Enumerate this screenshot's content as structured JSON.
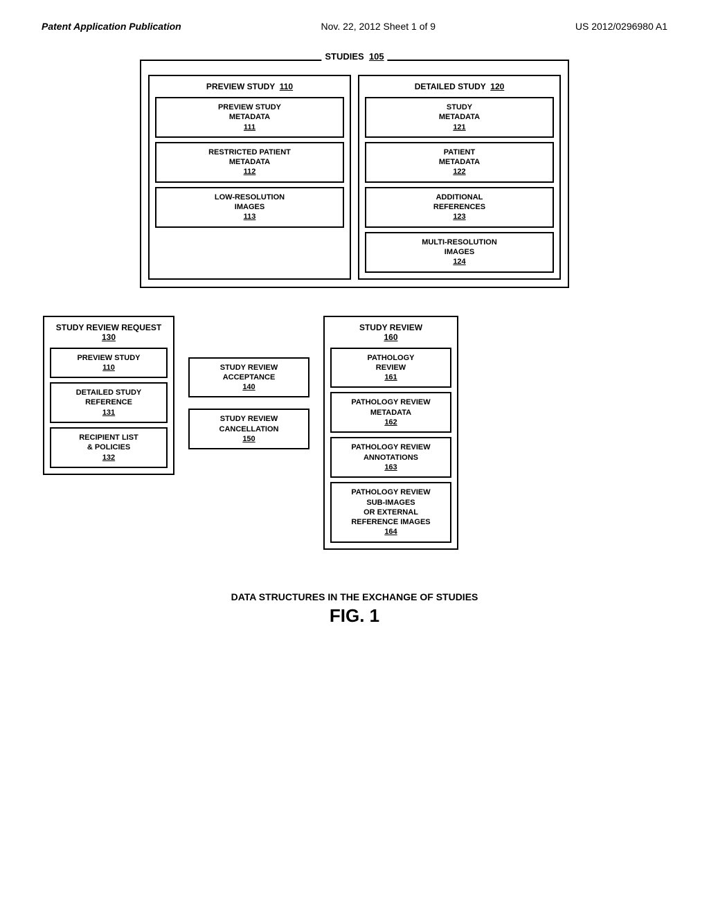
{
  "header": {
    "left": "Patent Application Publication",
    "center": "Nov. 22, 2012   Sheet 1 of 9",
    "right": "US 2012/0296980 A1"
  },
  "top_diagram": {
    "title": "STUDIES",
    "title_ref": "105",
    "preview_study": {
      "label": "PREVIEW STUDY",
      "ref": "110",
      "boxes": [
        {
          "label": "PREVIEW STUDY\nMETADATA",
          "ref": "111"
        },
        {
          "label": "RESTRICTED PATIENT\nMETADATA",
          "ref": "112"
        },
        {
          "label": "LOW-RESOLUTION\nIMAGES",
          "ref": "113"
        }
      ]
    },
    "detailed_study": {
      "label": "DETAILED STUDY",
      "ref": "120",
      "boxes": [
        {
          "label": "STUDY\nMETADATA",
          "ref": "121"
        },
        {
          "label": "PATIENT\nMETADATA",
          "ref": "122"
        },
        {
          "label": "ADDITIONAL\nREFERENCES",
          "ref": "123"
        },
        {
          "label": "MULTI-RESOLUTION\nIMAGES",
          "ref": "124"
        }
      ]
    }
  },
  "bottom_diagram": {
    "srr": {
      "title": "STUDY REVIEW REQUEST",
      "ref": "130",
      "boxes": [
        {
          "label": "PREVIEW STUDY",
          "ref": "110"
        },
        {
          "label": "DETAILED STUDY\nREFERENCE",
          "ref": "131"
        },
        {
          "label": "RECIPIENT LIST\n& POLICIES",
          "ref": "132"
        }
      ]
    },
    "middle": [
      {
        "label": "STUDY REVIEW\nACCEPTANCE",
        "ref": "140"
      },
      {
        "label": "STUDY REVIEW\nCANCELLATION",
        "ref": "150"
      }
    ],
    "sr": {
      "title": "STUDY REVIEW",
      "ref": "160",
      "boxes": [
        {
          "label": "PATHOLOGY\nREVIEW",
          "ref": "161"
        },
        {
          "label": "PATHOLOGY REVIEW\nMETADATA",
          "ref": "162"
        },
        {
          "label": "PATHOLOGY REVIEW\nANNOTATIONS",
          "ref": "163"
        },
        {
          "label": "PATHOLOGY REVIEW\nSUB-IMAGES\nOR EXTERNAL\nREFERENCE IMAGES",
          "ref": "164"
        }
      ]
    }
  },
  "caption": {
    "line1": "DATA STRUCTURES IN THE EXCHANGE OF STUDIES",
    "line2": "FIG. 1"
  }
}
